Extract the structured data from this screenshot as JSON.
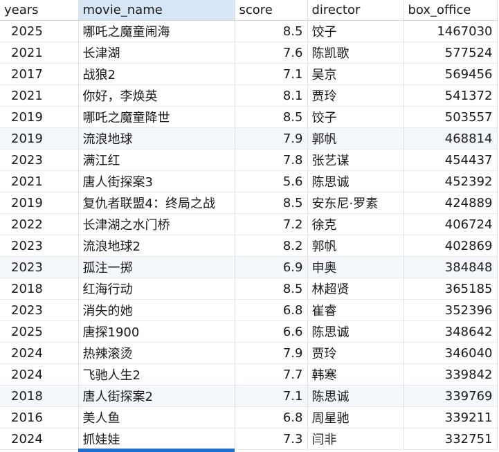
{
  "columns": [
    "years",
    "movie_name",
    "score",
    "director",
    "box_office"
  ],
  "rows": [
    [
      "2025",
      "哪吒之魔童闹海",
      "8.5",
      "饺子",
      "1467030"
    ],
    [
      "2021",
      "长津湖",
      "7.6",
      "陈凯歌",
      "577524"
    ],
    [
      "2017",
      "战狼2",
      "7.1",
      "吴京",
      "569456"
    ],
    [
      "2021",
      "你好，李焕英",
      "8.1",
      "贾玲",
      "541372"
    ],
    [
      "2019",
      "哪吒之魔童降世",
      "8.5",
      "饺子",
      "503557"
    ],
    [
      "2019",
      "流浪地球",
      "7.9",
      "郭帆",
      "468814"
    ],
    [
      "2023",
      "满江红",
      "7.8",
      "张艺谋",
      "454437"
    ],
    [
      "2021",
      "唐人街探案3",
      "5.6",
      "陈思诚",
      "452392"
    ],
    [
      "2019",
      "复仇者联盟4：终局之战",
      "8.5",
      "安东尼·罗素",
      "424889"
    ],
    [
      "2022",
      "长津湖之水门桥",
      "7.2",
      "徐克",
      "406724"
    ],
    [
      "2023",
      "流浪地球2",
      "8.2",
      "郭帆",
      "402869"
    ],
    [
      "2023",
      "孤注一掷",
      "6.9",
      "申奥",
      "384848"
    ],
    [
      "2018",
      "红海行动",
      "8.5",
      "林超贤",
      "365185"
    ],
    [
      "2023",
      "消失的她",
      "6.8",
      "崔睿",
      "352396"
    ],
    [
      "2025",
      "唐探1900",
      "6.6",
      "陈思诚",
      "348642"
    ],
    [
      "2024",
      "热辣滚烫",
      "7.9",
      "贾玲",
      "346040"
    ],
    [
      "2024",
      "飞驰人生2",
      "7.7",
      "韩寒",
      "339842"
    ],
    [
      "2018",
      "唐人街探案2",
      "7.1",
      "陈思诚",
      "339769"
    ],
    [
      "2016",
      "美人鱼",
      "6.8",
      "周星驰",
      "339211"
    ],
    [
      "2024",
      "抓娃娃",
      "7.3",
      "闫非",
      "332751"
    ]
  ],
  "selected_column": "movie_name",
  "highlighted_rows": [
    5,
    11,
    17
  ],
  "colors": {
    "header_selected": "#d6e6f7",
    "row_highlight": "#f4f8fd",
    "selection_bar": "#1e6fd0"
  }
}
